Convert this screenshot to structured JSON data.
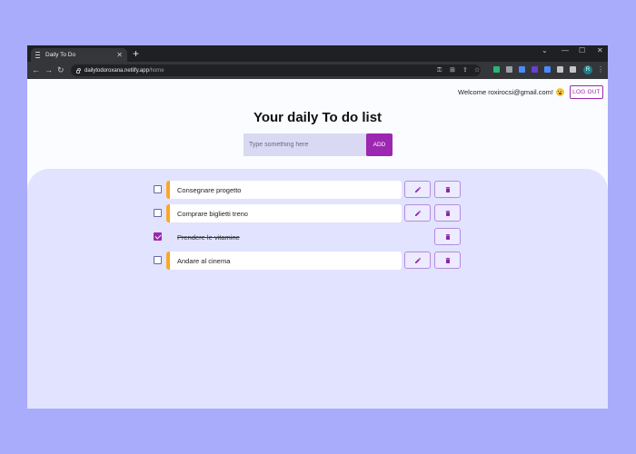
{
  "browser": {
    "tab_title": "Daily To Do",
    "tab_close": "✕",
    "new_tab": "+",
    "url_host": "dailytodoroxana.netlify.app",
    "url_path": "/home",
    "window_controls": [
      "⌄",
      "—",
      "☐",
      "✕"
    ],
    "profile_initial": "R",
    "extension_colors": [
      "#2bb673",
      "#9aa0a6",
      "#4a8cff",
      "#6a3fd2",
      "#4a8cff",
      "#c6c6c6",
      "#c6c6c6"
    ]
  },
  "header": {
    "welcome": "Welcome roxirocsi@gmail.com!",
    "logout": "LOG OUT"
  },
  "main": {
    "title": "Your daily To do list",
    "input_placeholder": "Type something here",
    "add_label": "ADD"
  },
  "todos": [
    {
      "text": "Consegnare progetto",
      "done": false
    },
    {
      "text": "Comprare biglietti treno",
      "done": false
    },
    {
      "text": "Prendere le vitamine",
      "done": true
    },
    {
      "text": "Andare al cinema",
      "done": false
    }
  ],
  "colors": {
    "accent": "#9c27b0",
    "item_marker": "#f9a825",
    "list_background": "#e2e3ff",
    "outer_background": "#a9acfb"
  }
}
